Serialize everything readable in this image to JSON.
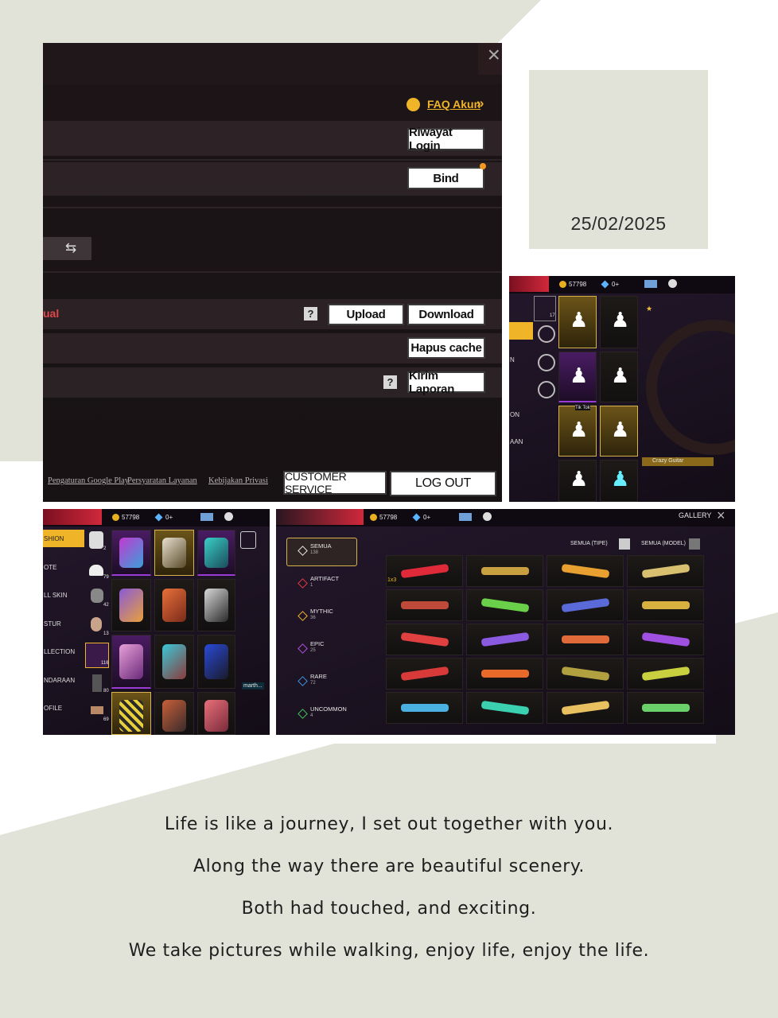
{
  "date": "25/02/2025",
  "settings_panel": {
    "faq_label": "FAQ Akun",
    "faq_chevron": "»",
    "riwayat_login": "Riwayat Login",
    "bind": "Bind",
    "partial_label": "ual",
    "upload": "Upload",
    "download": "Download",
    "hapus_cache": "Hapus cache",
    "kirim_laporan": "Kirim Laporan",
    "help": "?",
    "close": "×",
    "footer_links": [
      "Pengaturan Google Play",
      "Persyaratan Layanan",
      "Kebijakan Privasi"
    ],
    "customer_service": "CUSTOMER SERVICE",
    "log_out": "LOG OUT"
  },
  "emote_panel": {
    "coins": "57798",
    "diamonds": "0+",
    "side_labels": [
      "N",
      "ON",
      "AAN"
    ],
    "badge": "Tik Tok",
    "item_name": "Crazy Guitar",
    "count": "17"
  },
  "fashion_panel": {
    "coins": "57798",
    "diamonds": "0+",
    "categories": [
      "SHION",
      "OTE",
      "LL SKIN",
      "STUR",
      "LLECTION",
      "NDARAAN",
      "OFILE"
    ],
    "counts": [
      "2",
      "79",
      "42",
      "13",
      "116",
      "80",
      "69"
    ],
    "tag": "marth..."
  },
  "gallery_panel": {
    "coins": "57798",
    "diamonds": "0+",
    "title": "GALLERY",
    "filter_type": "SEMUA (TIPE)",
    "filter_model": "SEMUA (MODEL)",
    "rarities": [
      {
        "name": "SEMUA",
        "count": "138",
        "color": "#e8e8e8"
      },
      {
        "name": "ARTIFACT",
        "count": "1",
        "color": "#e23b3b"
      },
      {
        "name": "MYTHIC",
        "count": "36",
        "color": "#f0b428"
      },
      {
        "name": "EPIC",
        "count": "25",
        "color": "#b24ee0"
      },
      {
        "name": "RARE",
        "count": "72",
        "color": "#3f8fe0"
      },
      {
        "name": "UNCOMMON",
        "count": "4",
        "color": "#3fc25a"
      }
    ],
    "first_item_qty": "1x3"
  },
  "quote_lines": [
    "Life is like a journey, I set out together with you.",
    "Along the way there are beautiful scenery.",
    "Both had touched, and exciting.",
    "We take pictures while walking, enjoy life, enjoy the life."
  ],
  "colors": {
    "background_shape": "#e1e3d8",
    "accent_gold": "#f0b428",
    "panel_dark": "#1a1416"
  }
}
